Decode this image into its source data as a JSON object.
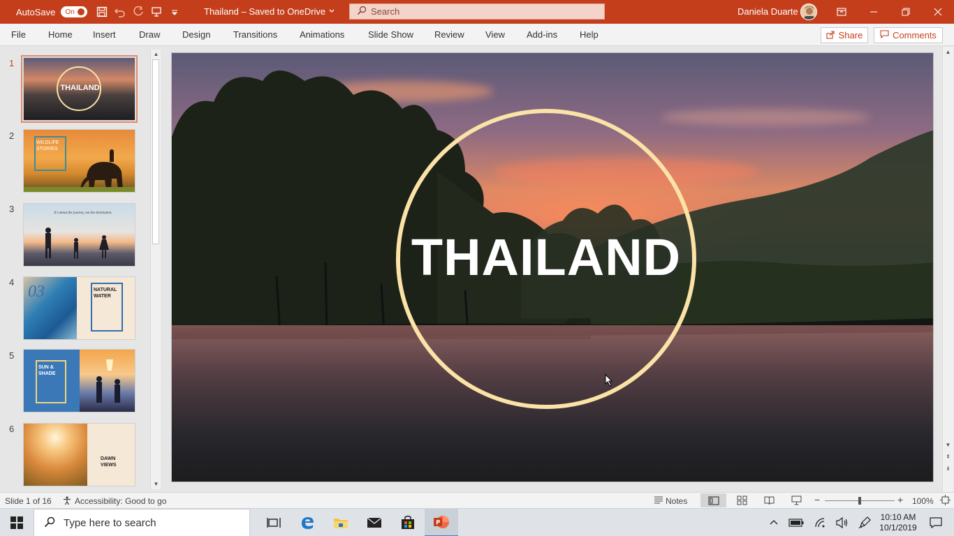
{
  "titlebar": {
    "autosave_label": "AutoSave",
    "autosave_state": "On",
    "file_title": "Thailand – Saved to OneDrive",
    "search_placeholder": "Search",
    "user_name": "Daniela Duarte",
    "accent_color": "#c43e1c"
  },
  "ribbon": {
    "tabs": [
      "File",
      "Home",
      "Insert",
      "Draw",
      "Design",
      "Transitions",
      "Animations",
      "Slide Show",
      "Review",
      "View",
      "Add-ins",
      "Help"
    ],
    "share_label": "Share",
    "comments_label": "Comments"
  },
  "thumbnails": {
    "numbers": [
      "1",
      "2",
      "3",
      "4",
      "5",
      "6"
    ],
    "slide1_text": "THAILAND",
    "slide2_text": "WILDLIFE STORIES",
    "slide3_text": "It's about the journey, not the destination.",
    "slide4_number": "03",
    "slide4_text": "NATURAL WATER",
    "slide5_text": "SUN & SHADE",
    "slide6_text": "DAWN VIEWS"
  },
  "slide": {
    "title": "THAILAND",
    "ring_color": "#fbe2a6"
  },
  "status": {
    "slide_position": "Slide 1 of 16",
    "accessibility": "Accessibility: Good to go",
    "notes_label": "Notes",
    "zoom": "100%",
    "zoom_fraction": 0.5
  },
  "taskbar": {
    "search_placeholder": "Type here to search",
    "time": "10:10 AM",
    "date": "10/1/2019"
  }
}
